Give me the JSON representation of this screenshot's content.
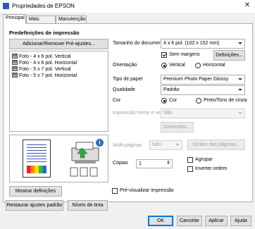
{
  "window": {
    "title": "Propriedades de EPSON",
    "close_glyph": "✕"
  },
  "tabs": [
    {
      "label": "Principal",
      "active": true
    },
    {
      "label": "Mais opções",
      "active": false
    },
    {
      "label": "Manutenção",
      "active": false
    }
  ],
  "presets": {
    "heading": "Predefinições de impressão",
    "add_remove_label": "Adicionar/Remover Pré-ajustes...",
    "items": [
      "Foto - 4 x 6 pol. Vertical",
      "Foto - 4 x 6 pol. Horizontal",
      "Foto - 5 x 7 pol. Vertical",
      "Foto - 5 x 7 pol. Horizontal"
    ]
  },
  "preview": {
    "info_glyph": "i"
  },
  "buttons": {
    "show_settings": "Mostrar definições",
    "restore_defaults": "Restaurar ajustes padrão",
    "ink_levels": "Níveis de tinta",
    "ok": "OK",
    "cancel": "Cancelar",
    "apply": "Aplicar",
    "help": "Ajuda"
  },
  "settings": {
    "doc_size_label": "Tamanho do documento",
    "doc_size_value": "4 x 6 pol. (102 x 152 mm)",
    "borderless_label": "Sem margens",
    "borderless_checked": true,
    "borderless_settings": "Definições...",
    "orientation_label": "Orientação",
    "orientation_vertical": "Vertical",
    "orientation_horizontal": "Horizontal",
    "orientation_selected": "Vertical",
    "paper_type_label": "Tipo de papel",
    "paper_type_value": "Premium Photo Paper Glossy",
    "quality_label": "Qualidade",
    "quality_value": "Padrão",
    "color_label": "Cor",
    "color_option": "Cor",
    "grayscale_option": "Preto/Tons de cinza",
    "color_selected": "Cor",
    "duplex_label": "Impressão frente e verso",
    "duplex_value": "Não",
    "duplex_settings": "Definições...",
    "multipage_label": "Multi-páginas",
    "multipage_value": "Não",
    "page_order": "Ordem das páginas...",
    "copies_label": "Cópias",
    "copies_value": "1",
    "collate_label": "Agrupar",
    "collate_checked": false,
    "reverse_label": "Inverter ordem",
    "reverse_checked": false,
    "print_preview_label": "Pré-visualizar impressão",
    "print_preview_checked": false
  }
}
